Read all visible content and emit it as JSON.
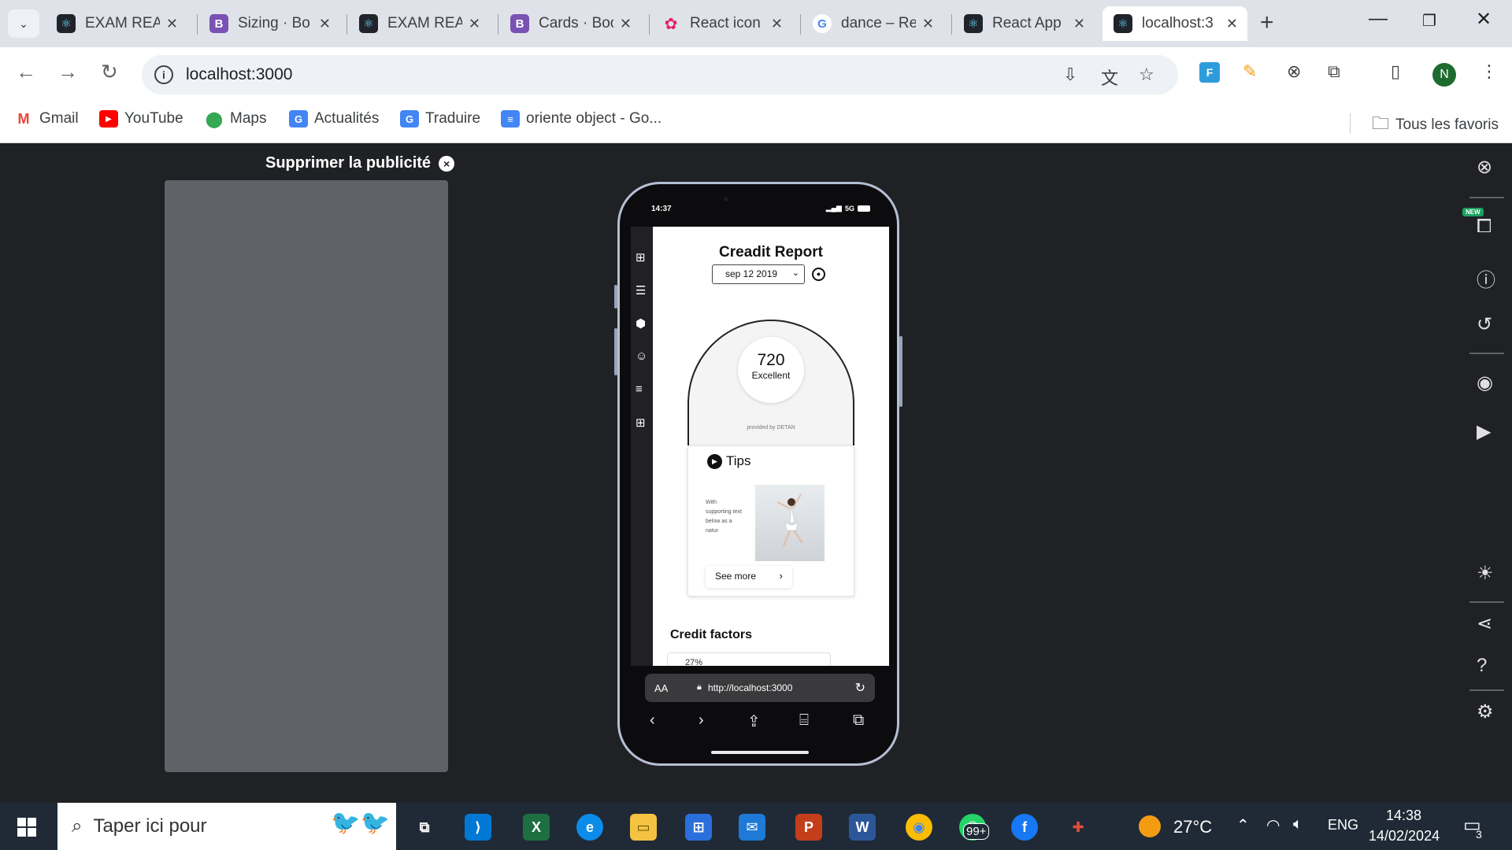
{
  "browser": {
    "tabs": [
      {
        "title": "EXAM REA",
        "icon": "react-icon",
        "color": "#61dafb"
      },
      {
        "title": "Sizing · Bo",
        "icon": "bootstrap-icon",
        "color": "#7952b3"
      },
      {
        "title": "EXAM REA",
        "icon": "react-icon",
        "color": "#61dafb"
      },
      {
        "title": "Cards · Boo",
        "icon": "bootstrap-icon",
        "color": "#7952b3"
      },
      {
        "title": "React icon",
        "icon": "react-icons-icon",
        "color": "#e91e63"
      },
      {
        "title": "dance – Re",
        "icon": "google-icon",
        "color": "#4285f4"
      },
      {
        "title": "React App",
        "icon": "react-icon",
        "color": "#61dafb"
      },
      {
        "title": "localhost:3",
        "icon": "react-icon",
        "color": "#61dafb",
        "active": true
      }
    ],
    "url": "localhost:3000",
    "profile_initial": "N",
    "extension_label": "F",
    "bookmarks": [
      {
        "label": "Gmail",
        "icon": "gmail-icon",
        "color": "#ea4335",
        "glyph": "M"
      },
      {
        "label": "YouTube",
        "icon": "youtube-icon",
        "color": "#ff0000",
        "glyph": "▶"
      },
      {
        "label": "Maps",
        "icon": "maps-icon",
        "color": "#34a853",
        "glyph": "●"
      },
      {
        "label": "Actualités",
        "icon": "news-icon",
        "color": "#4285f4",
        "glyph": "G"
      },
      {
        "label": "Traduire",
        "icon": "translate-icon",
        "color": "#4285f4",
        "glyph": "G"
      },
      {
        "label": "oriente object - Go...",
        "icon": "docs-icon",
        "color": "#4285f4",
        "glyph": "≡"
      }
    ],
    "all_bookmarks": "Tous les favoris"
  },
  "ad": {
    "label": "Supprimer la publicité",
    "close": "×"
  },
  "phone": {
    "time": "14:37",
    "network": "5G",
    "app": {
      "title": "Creadit Report",
      "date": "sep 12 2019",
      "score": "720",
      "rating": "Excellent",
      "provided_by": "provided by DETAN",
      "tips_title": "Tips",
      "tips_text": "With supporting text below as a natur",
      "see_more": "See more",
      "factors_title": "Credit factors",
      "factors_value": "27%"
    },
    "safari": {
      "aa": "AA",
      "url": "http://localhost:3000"
    }
  },
  "taskbar": {
    "search_placeholder": "Taper ici pour",
    "whatsapp_badge": "99+",
    "weather": "27°C",
    "language": "ENG",
    "time": "14:38",
    "date": "14/02/2024",
    "notifications": "3"
  }
}
